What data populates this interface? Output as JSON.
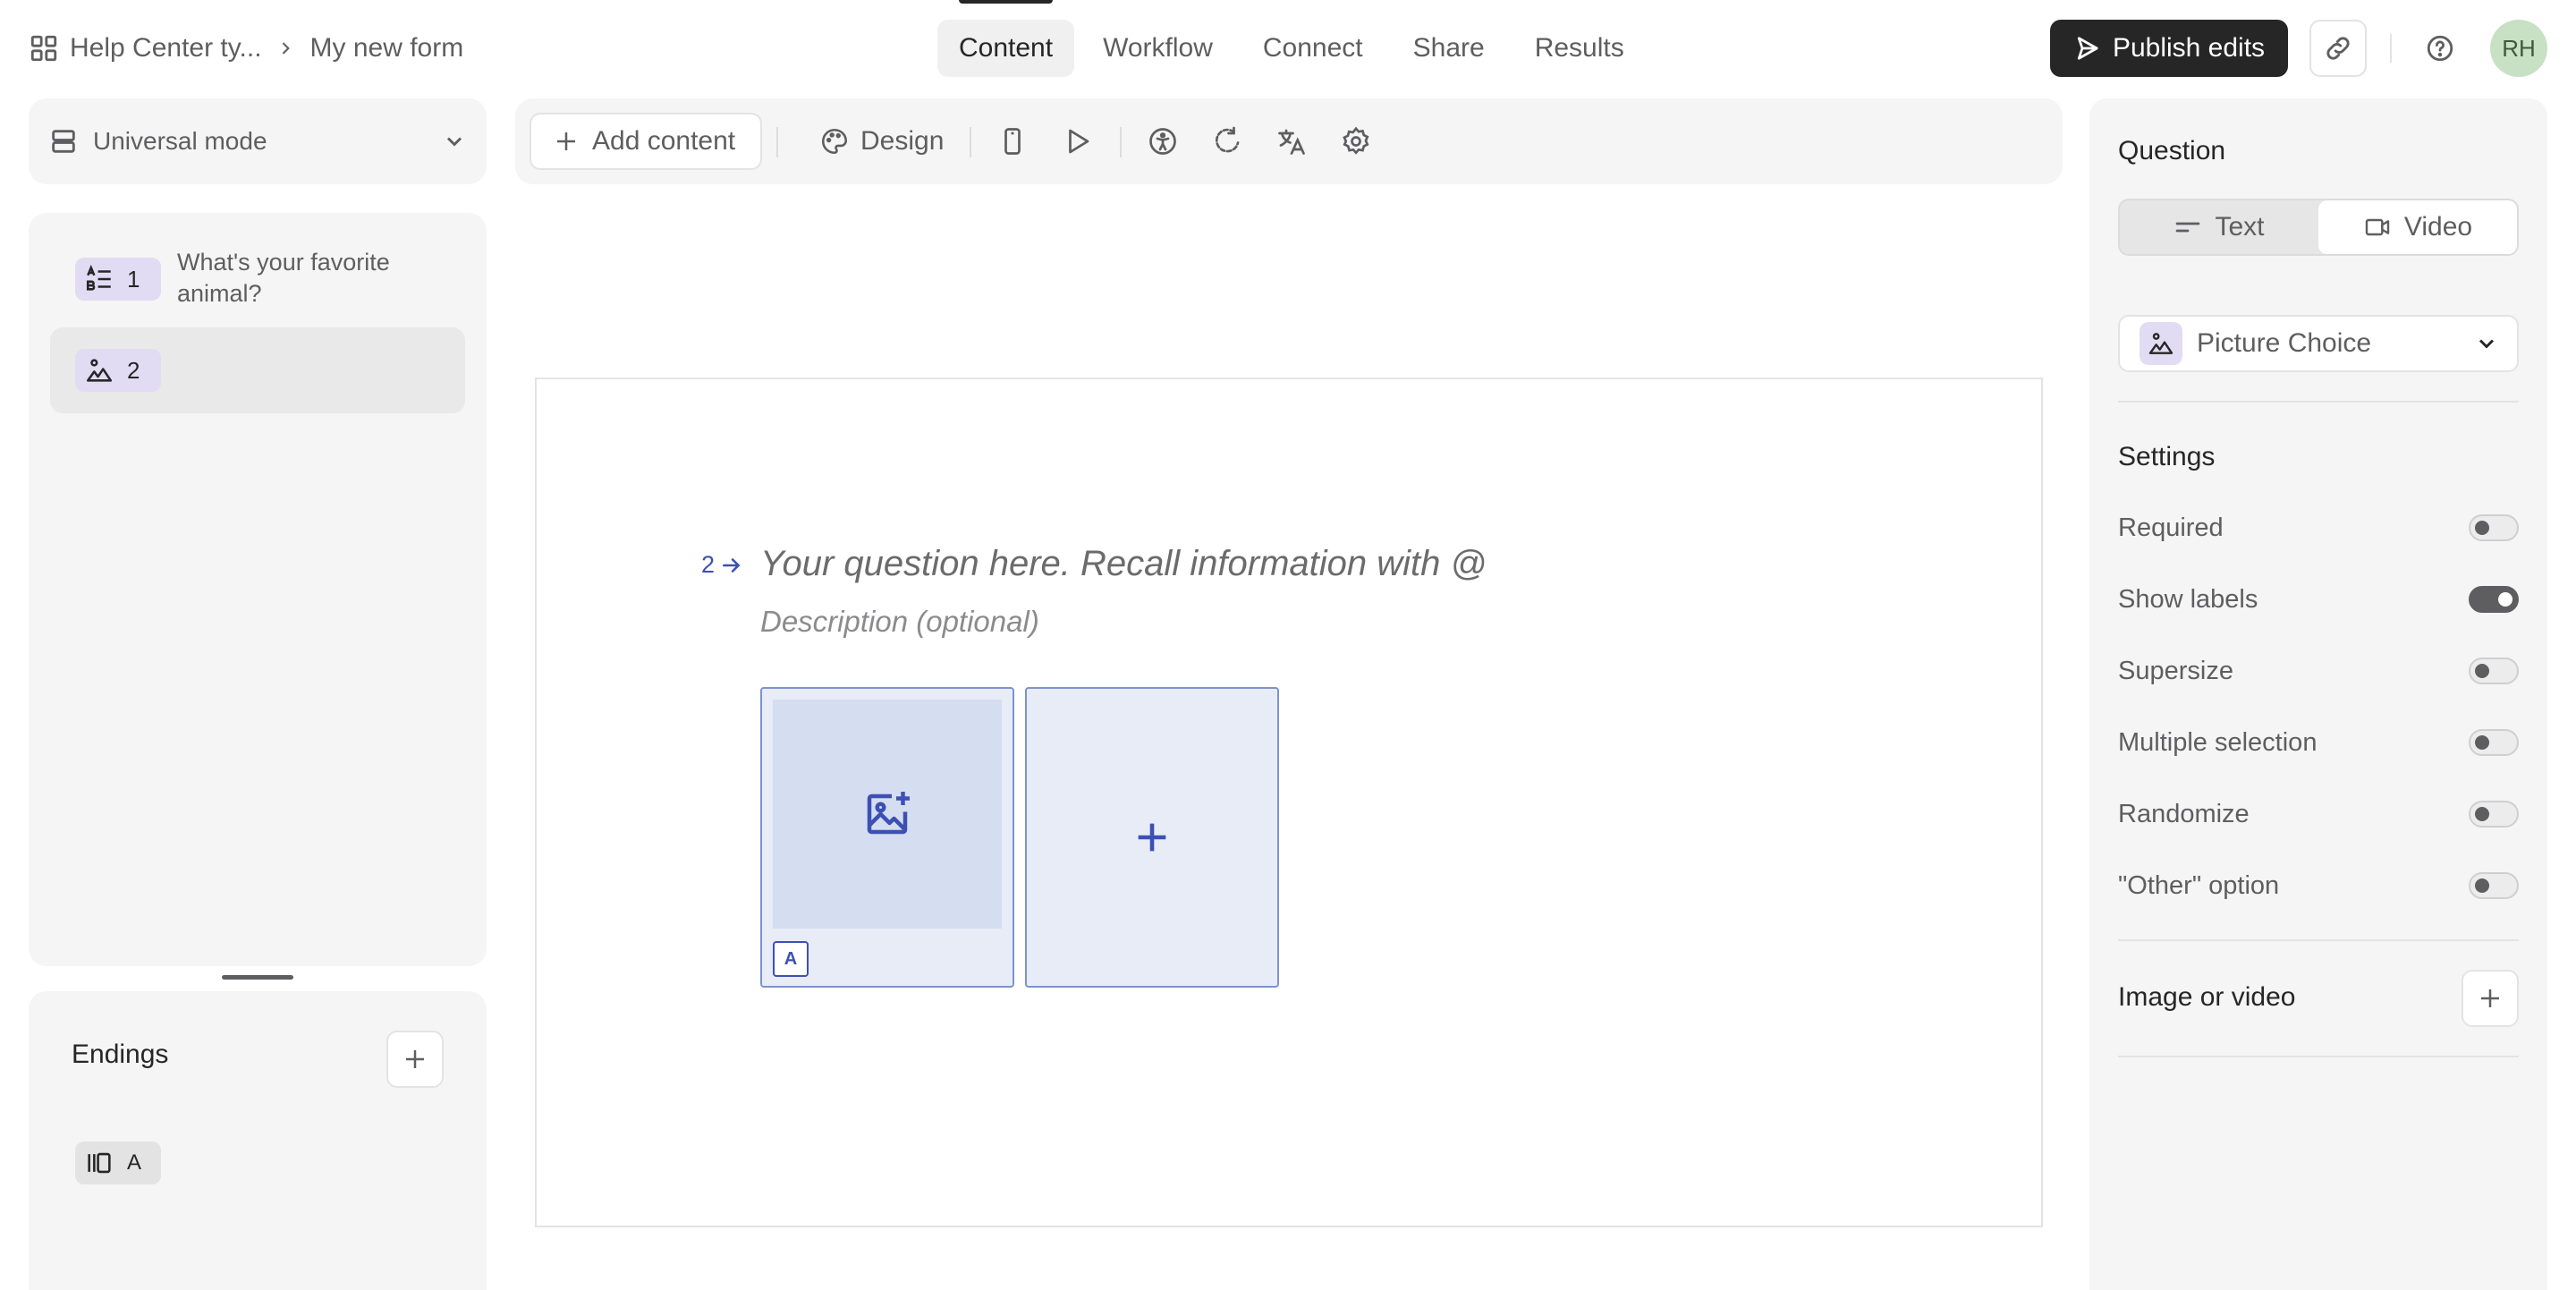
{
  "header": {
    "workspace": "Help Center ty...",
    "form_name": "My new form",
    "tabs": [
      {
        "label": "Content",
        "active": true
      },
      {
        "label": "Workflow",
        "active": false
      },
      {
        "label": "Connect",
        "active": false
      },
      {
        "label": "Share",
        "active": false
      },
      {
        "label": "Results",
        "active": false
      }
    ],
    "publish_label": "Publish edits",
    "avatar_initials": "RH"
  },
  "left_panel": {
    "mode_label": "Universal mode",
    "questions": [
      {
        "number": "1",
        "text": "What's your favorite animal?",
        "icon": "multiple-choice-icon"
      },
      {
        "number": "2",
        "text": "",
        "icon": "picture-choice-icon",
        "selected": true
      }
    ],
    "endings": {
      "title": "Endings",
      "items": [
        {
          "label": "A",
          "icon": "ending-icon"
        }
      ]
    }
  },
  "toolbar": {
    "add_content_label": "Add content",
    "design_label": "Design"
  },
  "canvas": {
    "question_number": "2",
    "question_placeholder": "Your question here. Recall information with @",
    "description_placeholder": "Description (optional)",
    "choices": [
      {
        "key": "A"
      }
    ]
  },
  "right_panel": {
    "question_label": "Question",
    "format_options": [
      {
        "label": "Text",
        "selected": true
      },
      {
        "label": "Video",
        "selected": false
      }
    ],
    "question_type": "Picture Choice",
    "settings_label": "Settings",
    "settings": [
      {
        "label": "Required",
        "on": false
      },
      {
        "label": "Show labels",
        "on": true
      },
      {
        "label": "Supersize",
        "on": false
      },
      {
        "label": "Multiple selection",
        "on": false
      },
      {
        "label": "Randomize",
        "on": false
      },
      {
        "label": "\"Other\" option",
        "on": false
      }
    ],
    "image_or_video_label": "Image or video"
  },
  "colors": {
    "accent": "#3c50b4",
    "publish_bg": "#262627",
    "question_badge": "#e1dcf3",
    "avatar_bg": "#c8e0c4"
  }
}
